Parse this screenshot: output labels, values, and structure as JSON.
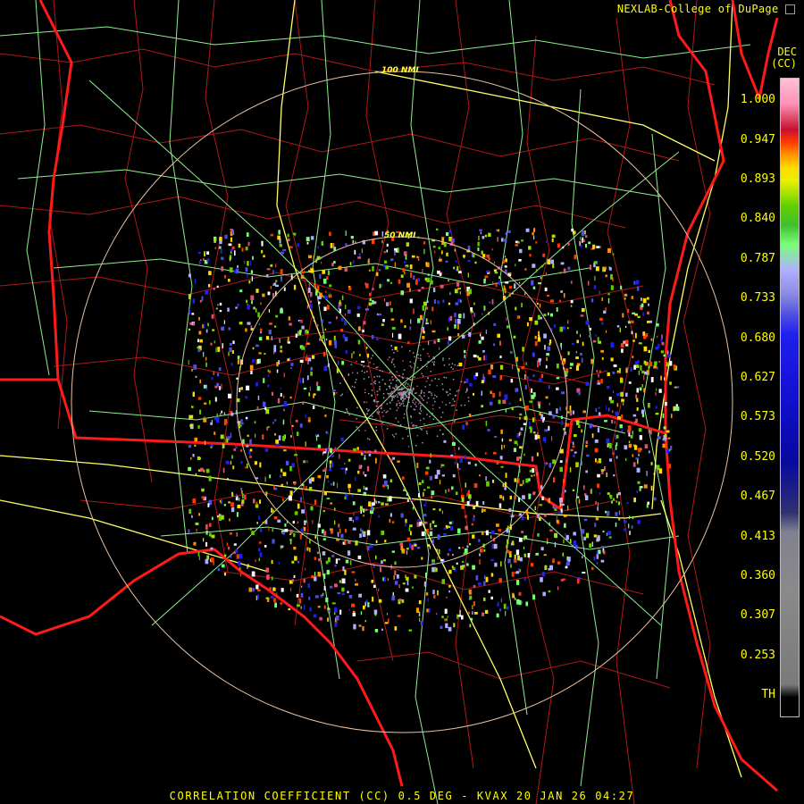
{
  "credit": "NEXLAB-College of DuPage",
  "legend": {
    "unit_line1": "DEC",
    "unit_line2": "(CC)",
    "ticks": [
      "1.000",
      "0.947",
      "0.893",
      "0.840",
      "0.787",
      "0.733",
      "0.680",
      "0.627",
      "0.573",
      "0.520",
      "0.467",
      "0.413",
      "0.360",
      "0.307",
      "0.253",
      "TH"
    ]
  },
  "range_rings": [
    {
      "label": "50 NMI",
      "radius_nmi": 50
    },
    {
      "label": "100 NMI",
      "radius_nmi": 100
    }
  ],
  "caption": "CORRELATION COEFFICIENT (CC) 0.5 DEG - KVAX 20 JAN 26 04:27",
  "colors": {
    "background": "#000000",
    "state_borders": "#ff1a1a",
    "county_borders": "#b01818",
    "highways": "#ffff66",
    "roads": "#90ee90",
    "text": "#ffff00",
    "ring": "#e8c0a0"
  },
  "icons": [
    "nexlab-logo-icon"
  ]
}
